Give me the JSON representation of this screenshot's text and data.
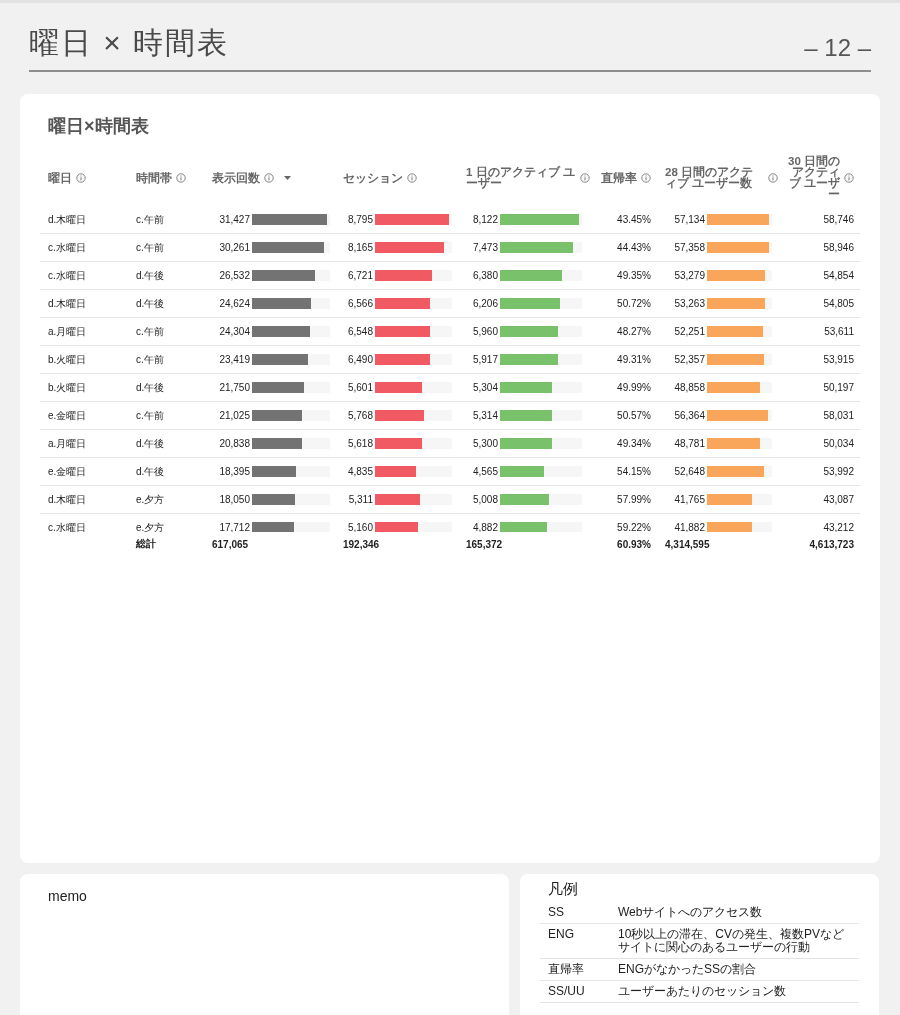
{
  "page": {
    "title": "曜日 × 時間表",
    "page_number": "– 12 –"
  },
  "table": {
    "title": "曜日×時間表",
    "columns": [
      {
        "label": "曜日",
        "info": true,
        "sorted": false,
        "kind": "text"
      },
      {
        "label": "時間帯",
        "info": true,
        "sorted": false,
        "kind": "text"
      },
      {
        "label": "表示回数",
        "info": true,
        "sorted": true,
        "kind": "bar",
        "color": "#737373"
      },
      {
        "label": "セッション",
        "info": true,
        "sorted": false,
        "kind": "bar",
        "color": "#f25a63"
      },
      {
        "label": "1 日のアクティブ ユーザー",
        "info": true,
        "sorted": false,
        "kind": "bar",
        "color": "#79c26b"
      },
      {
        "label": "直帰率",
        "info": true,
        "sorted": false,
        "kind": "number"
      },
      {
        "label": "28 日間のアクティブ ユーザー数",
        "info": true,
        "sorted": false,
        "kind": "bar",
        "color": "#f9a55a"
      },
      {
        "label": "30 日間のアクティブ ユーザー",
        "info": true,
        "sorted": false,
        "kind": "number"
      }
    ],
    "rows": [
      {
        "cells": [
          {
            "text": "d.木曜日"
          },
          {
            "text": "c.午前"
          },
          {
            "text": "31,427",
            "level": 1
          },
          {
            "text": "8,795",
            "level": 1
          },
          {
            "text": "8,122",
            "level": 1
          },
          {
            "text": "43.45%"
          },
          {
            "text": "57,134",
            "level": 0.996
          },
          {
            "text": "58,746"
          }
        ]
      },
      {
        "cells": [
          {
            "text": "c.水曜日"
          },
          {
            "text": "c.午前"
          },
          {
            "text": "30,261",
            "level": 0.963
          },
          {
            "text": "8,165",
            "level": 0.928
          },
          {
            "text": "7,473",
            "level": 0.92
          },
          {
            "text": "44.43%"
          },
          {
            "text": "57,358",
            "level": 1
          },
          {
            "text": "58,946"
          }
        ]
      },
      {
        "cells": [
          {
            "text": "c.水曜日"
          },
          {
            "text": "d.午後"
          },
          {
            "text": "26,532",
            "level": 0.844
          },
          {
            "text": "6,721",
            "level": 0.764
          },
          {
            "text": "6,380",
            "level": 0.786
          },
          {
            "text": "49.35%"
          },
          {
            "text": "53,279",
            "level": 0.929
          },
          {
            "text": "54,854"
          }
        ]
      },
      {
        "cells": [
          {
            "text": "d.木曜日"
          },
          {
            "text": "d.午後"
          },
          {
            "text": "24,624",
            "level": 0.784
          },
          {
            "text": "6,566",
            "level": 0.747
          },
          {
            "text": "6,206",
            "level": 0.764
          },
          {
            "text": "50.72%"
          },
          {
            "text": "53,263",
            "level": 0.929
          },
          {
            "text": "54,805"
          }
        ]
      },
      {
        "cells": [
          {
            "text": "a.月曜日"
          },
          {
            "text": "c.午前"
          },
          {
            "text": "24,304",
            "level": 0.773
          },
          {
            "text": "6,548",
            "level": 0.745
          },
          {
            "text": "5,960",
            "level": 0.734
          },
          {
            "text": "48.27%"
          },
          {
            "text": "52,251",
            "level": 0.911
          },
          {
            "text": "53,611"
          }
        ]
      },
      {
        "cells": [
          {
            "text": "b.火曜日"
          },
          {
            "text": "c.午前"
          },
          {
            "text": "23,419",
            "level": 0.745
          },
          {
            "text": "6,490",
            "level": 0.738
          },
          {
            "text": "5,917",
            "level": 0.729
          },
          {
            "text": "49.31%"
          },
          {
            "text": "52,357",
            "level": 0.913
          },
          {
            "text": "53,915"
          }
        ]
      },
      {
        "cells": [
          {
            "text": "b.火曜日"
          },
          {
            "text": "d.午後"
          },
          {
            "text": "21,750",
            "level": 0.692
          },
          {
            "text": "5,601",
            "level": 0.637
          },
          {
            "text": "5,304",
            "level": 0.653
          },
          {
            "text": "49.99%"
          },
          {
            "text": "48,858",
            "level": 0.852
          },
          {
            "text": "50,197"
          }
        ]
      },
      {
        "cells": [
          {
            "text": "e.金曜日"
          },
          {
            "text": "c.午前"
          },
          {
            "text": "21,025",
            "level": 0.669
          },
          {
            "text": "5,768",
            "level": 0.656
          },
          {
            "text": "5,314",
            "level": 0.654
          },
          {
            "text": "50.57%"
          },
          {
            "text": "56,364",
            "level": 0.983
          },
          {
            "text": "58,031"
          }
        ]
      },
      {
        "cells": [
          {
            "text": "a.月曜日"
          },
          {
            "text": "d.午後"
          },
          {
            "text": "20,838",
            "level": 0.663
          },
          {
            "text": "5,618",
            "level": 0.639
          },
          {
            "text": "5,300",
            "level": 0.653
          },
          {
            "text": "49.34%"
          },
          {
            "text": "48,781",
            "level": 0.85
          },
          {
            "text": "50,034"
          }
        ]
      },
      {
        "cells": [
          {
            "text": "e.金曜日"
          },
          {
            "text": "d.午後"
          },
          {
            "text": "18,395",
            "level": 0.585
          },
          {
            "text": "4,835",
            "level": 0.55
          },
          {
            "text": "4,565",
            "level": 0.562
          },
          {
            "text": "54.15%"
          },
          {
            "text": "52,648",
            "level": 0.918
          },
          {
            "text": "53,992"
          }
        ]
      },
      {
        "cells": [
          {
            "text": "d.木曜日"
          },
          {
            "text": "e.夕方"
          },
          {
            "text": "18,050",
            "level": 0.574
          },
          {
            "text": "5,311",
            "level": 0.604
          },
          {
            "text": "5,008",
            "level": 0.617
          },
          {
            "text": "57.99%"
          },
          {
            "text": "41,765",
            "level": 0.728
          },
          {
            "text": "43,087"
          }
        ]
      },
      {
        "cells": [
          {
            "text": "c.水曜日"
          },
          {
            "text": "e.夕方"
          },
          {
            "text": "17,712",
            "level": 0.564
          },
          {
            "text": "5,160",
            "level": 0.587
          },
          {
            "text": "4,882",
            "level": 0.601
          },
          {
            "text": "59.22%"
          },
          {
            "text": "41,882",
            "level": 0.73
          },
          {
            "text": "43,212"
          }
        ]
      }
    ],
    "totals": {
      "label": "総計",
      "values": [
        "617,065",
        "192,346",
        "165,372",
        "60.93%",
        "4,314,595",
        "4,613,723"
      ]
    }
  },
  "memo": {
    "title": "memo"
  },
  "legend": {
    "title": "凡例",
    "rows": [
      {
        "term": "SS",
        "description": "Webサイトへのアクセス数"
      },
      {
        "term": "ENG",
        "description": "10秒以上の滞在、CVの発生、複数PVなどサイトに関心のあるユーザーの行動"
      },
      {
        "term": "直帰率",
        "description": "ENGがなかったSSの割合"
      },
      {
        "term": "SS/UU",
        "description": "ユーザーあたりのセッション数"
      }
    ]
  }
}
